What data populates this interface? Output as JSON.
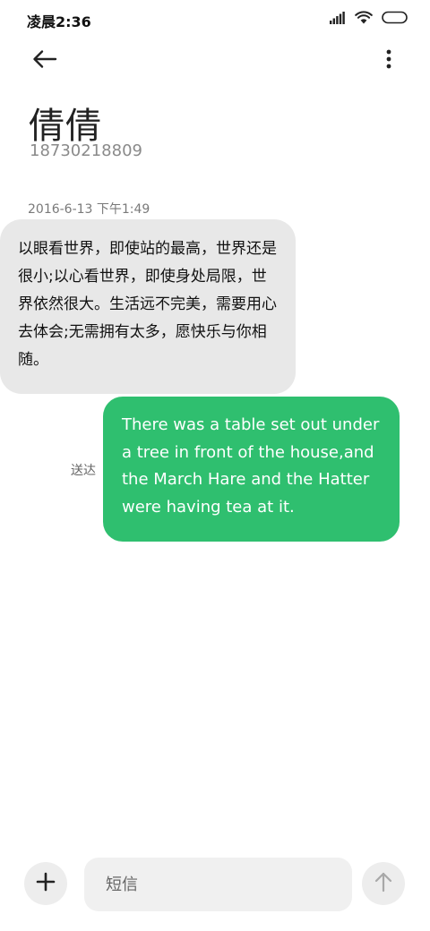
{
  "status_bar": {
    "time": "凌晨2:36",
    "icons": [
      "signal-icon",
      "wifi-icon",
      "battery-icon"
    ]
  },
  "app_bar": {
    "back_icon": "back-arrow-icon",
    "more_icon": "more-vertical-icon"
  },
  "contact": {
    "name": "倩倩",
    "number": "18730218809"
  },
  "conversation": {
    "timestamp": "2016-6-13 下午1:49",
    "incoming_message": "以眼看世界，即使站的最高，世界还是很小;以心看世界，即使身处局限，世界依然很大。生活远不完美，需要用心去体会;无需拥有太多，愿快乐与你相随。",
    "outgoing_message": "There was a table set out under a tree in front of the house,and the March Hare and the Hatter were having tea at it.",
    "sent_status": "送达"
  },
  "composer": {
    "placeholder": "短信",
    "add_icon": "plus-icon",
    "send_icon": "send-arrow-icon"
  },
  "colors": {
    "incoming_bubble": "#e8e8e8",
    "outgoing_bubble": "#2fbf6f",
    "background": "#ffffff"
  }
}
